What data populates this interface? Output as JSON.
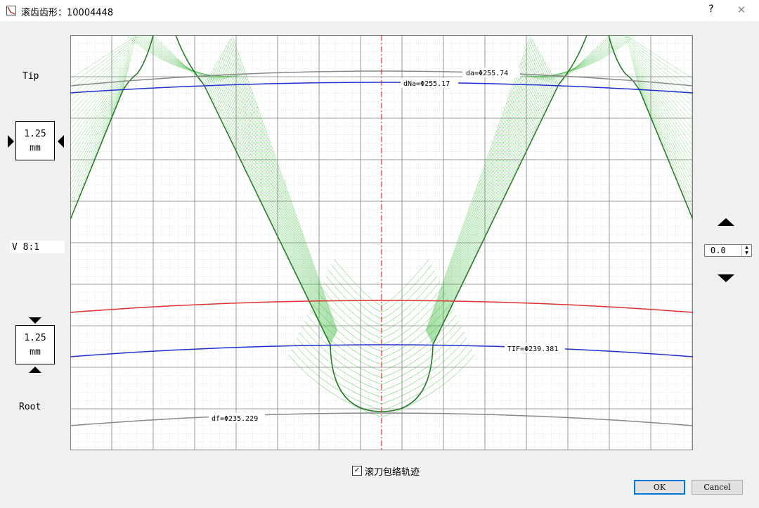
{
  "window": {
    "title": "滚齿齿形：10004448",
    "help": "?",
    "close": "✕"
  },
  "left_panel": {
    "tip_label": "Tip",
    "tip_box": {
      "value": "1.25",
      "unit": "mm"
    },
    "scale_label": "V 8:1",
    "root_box": {
      "value": "1.25",
      "unit": "mm"
    },
    "root_label": "Root"
  },
  "right_panel": {
    "spin_value": "0.0"
  },
  "plot": {
    "annotations": {
      "da": "da=Φ255.74",
      "dNa": "dNa=Φ255.17",
      "tif": "TIF=Φ239.381",
      "df": "df=Φ235.229"
    },
    "colors": {
      "tip_circle": "#888888",
      "dna_circle": "#1f2fd0",
      "red_circle": "#e03030",
      "tif_circle": "#1f2fd0",
      "root_circle": "#888888",
      "envelope": "#2db52d",
      "profile": "#2a7a2a",
      "centerline": "#e03030"
    }
  },
  "options": {
    "hob_envelope_label": "滚刀包络轨迹",
    "hob_envelope_checked": true
  },
  "buttons": {
    "ok": "OK",
    "cancel": "Cancel"
  }
}
